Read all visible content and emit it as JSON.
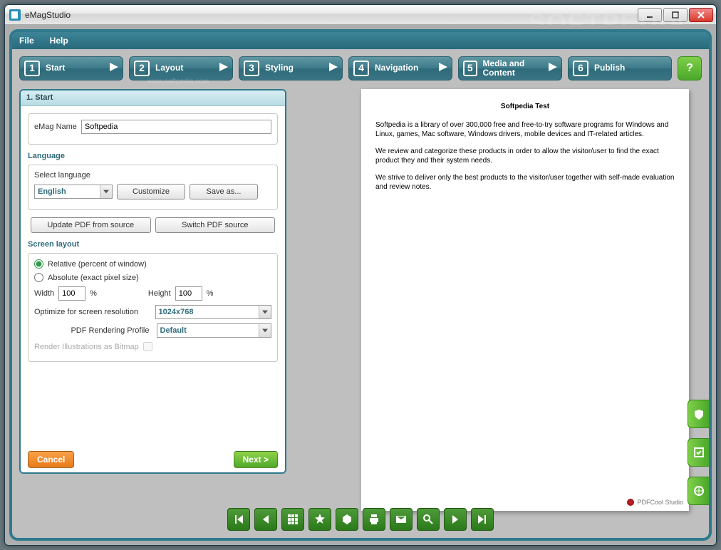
{
  "app_title": "eMagStudio",
  "menu": {
    "file": "File",
    "help": "Help"
  },
  "steps": [
    {
      "n": "1",
      "label": "Start"
    },
    {
      "n": "2",
      "label": "Layout"
    },
    {
      "n": "3",
      "label": "Styling"
    },
    {
      "n": "4",
      "label": "Navigation"
    },
    {
      "n": "5",
      "label": "Media and Content"
    },
    {
      "n": "6",
      "label": "Publish"
    }
  ],
  "wizard": {
    "title": "1. Start",
    "emag_name_label": "eMag Name",
    "emag_name_value": "Softpedia",
    "language_heading": "Language",
    "select_language_label": "Select language",
    "language_value": "English",
    "customize_btn": "Customize",
    "saveas_btn": "Save as...",
    "update_pdf_btn": "Update PDF from source",
    "switch_pdf_btn": "Switch PDF source",
    "screen_layout_heading": "Screen layout",
    "radio_relative": "Relative (percent of window)",
    "radio_absolute": "Absolute (exact pixel size)",
    "width_label": "Width",
    "width_value": "100",
    "width_unit": "%",
    "height_label": "Height",
    "height_value": "100",
    "height_unit": "%",
    "optimize_label": "Optimize for screen resolution",
    "optimize_value": "1024x768",
    "profile_label": "PDF Rendering Profile",
    "profile_value": "Default",
    "render_bitmap_label": "Render Illustrations as Bitmap",
    "cancel_btn": "Cancel",
    "next_btn": "Next >"
  },
  "preview": {
    "title": "Softpedia Test",
    "p1": "Softpedia is a library of over 300,000 free and free-to-try software programs for Windows and Linux, games, Mac software, Windows drivers, mobile devices and IT-related articles.",
    "p2": "We review and categorize these products in order to allow the visitor/user to find the exact product they and their system needs.",
    "p3": "We strive to deliver only the best products to the visitor/user together with self-made evaluation and review notes.",
    "footer": "PDFCool Studio"
  },
  "watermark": "SOFTPEDIA",
  "watermark_url": "www.softpedia.com"
}
